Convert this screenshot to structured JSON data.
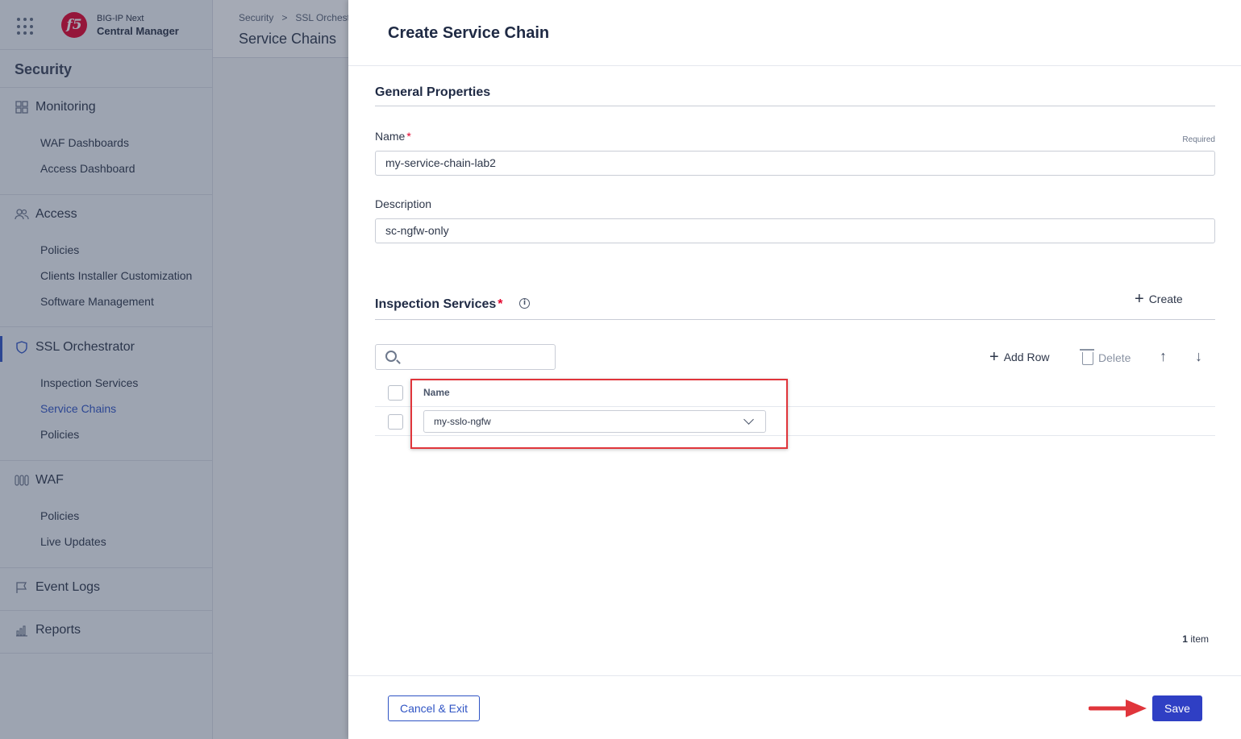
{
  "app": {
    "brand_line1": "BIG-IP Next",
    "brand_line2": "Central Manager",
    "logo_text": "f5",
    "section_title": "Security"
  },
  "sidebar": {
    "groups": [
      {
        "label": "Monitoring",
        "icon": "dashboard-grid-icon",
        "items": [
          "WAF Dashboards",
          "Access Dashboard"
        ]
      },
      {
        "label": "Access",
        "icon": "users-icon",
        "items": [
          "Policies",
          "Clients Installer Customization",
          "Software Management"
        ]
      },
      {
        "label": "SSL Orchestrator",
        "icon": "shield-icon",
        "items": [
          "Inspection Services",
          "Service Chains",
          "Policies"
        ]
      },
      {
        "label": "WAF",
        "icon": "waf-icon",
        "items": [
          "Policies",
          "Live Updates"
        ]
      },
      {
        "label": "Event Logs",
        "icon": "flag-icon",
        "items": []
      },
      {
        "label": "Reports",
        "icon": "bar-chart-icon",
        "items": []
      }
    ],
    "active_item": "Service Chains"
  },
  "main": {
    "breadcrumb": [
      "Security",
      "SSL Orchestrator"
    ],
    "breadcrumb_sep": ">",
    "page_title": "Service Chains"
  },
  "drawer": {
    "title": "Create Service Chain",
    "general_heading": "General Properties",
    "name_label": "Name",
    "required_marker": "*",
    "required_hint": "Required",
    "name_value": "my-service-chain-lab2",
    "description_label": "Description",
    "description_value": "sc-ngfw-only",
    "inspection_heading": "Inspection Services",
    "info_glyph": "i",
    "create_label": "Create",
    "toolbar": {
      "add_row": "Add Row",
      "delete": "Delete",
      "move_up": "↑",
      "move_down": "↓"
    },
    "search_placeholder": "",
    "table": {
      "column_name": "Name",
      "rows": [
        {
          "name": "my-sslo-ngfw"
        }
      ]
    },
    "item_count": "1",
    "item_label": "item",
    "cancel_label": "Cancel & Exit",
    "save_label": "Save"
  },
  "colors": {
    "accent": "#2f54c4",
    "primary_button": "#2f3fc4",
    "required": "#e4002b",
    "highlight_annotation": "#e0353b"
  }
}
